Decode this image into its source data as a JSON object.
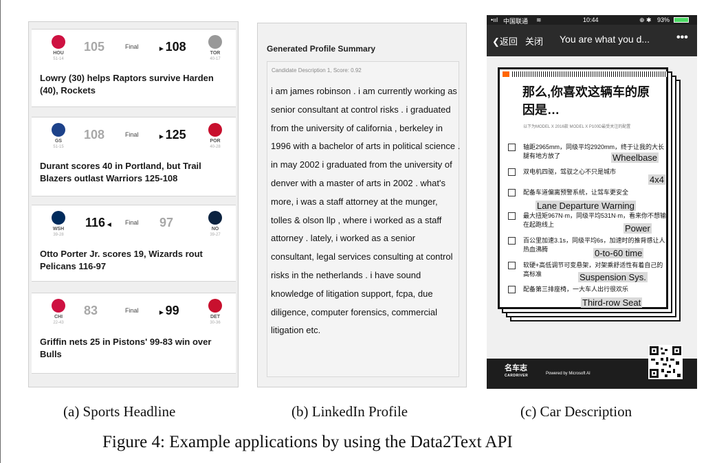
{
  "panel_a": {
    "games": [
      {
        "away": {
          "abbr": "HOU",
          "record": "51-14",
          "score": "105",
          "color": "#ce1141"
        },
        "home": {
          "abbr": "TOR",
          "record": "40-17",
          "score": "108",
          "color": "#999999"
        },
        "status": "Final",
        "winner": "home",
        "headline": "Lowry (30) helps Raptors survive Harden (40), Rockets"
      },
      {
        "away": {
          "abbr": "GS",
          "record": "51-15",
          "score": "108",
          "color": "#1d428a"
        },
        "home": {
          "abbr": "POR",
          "record": "40-28",
          "score": "125",
          "color": "#c8102e"
        },
        "status": "Final",
        "winner": "home",
        "headline": "Durant scores 40 in Portland, but Trail Blazers outlast Warriors 125-108"
      },
      {
        "away": {
          "abbr": "WSH",
          "record": "39-28",
          "score": "116",
          "color": "#002b5c"
        },
        "home": {
          "abbr": "NO",
          "record": "39-27",
          "score": "97",
          "color": "#0c2340"
        },
        "status": "Final",
        "winner": "away",
        "headline": "Otto Porter Jr. scores 19, Wizards rout Pelicans 116-97"
      },
      {
        "away": {
          "abbr": "CHI",
          "record": "22-43",
          "score": "83",
          "color": "#ce1141"
        },
        "home": {
          "abbr": "DET",
          "record": "30-36",
          "score": "99",
          "color": "#c8102e"
        },
        "status": "Final",
        "winner": "home",
        "headline": "Griffin nets 25 in Pistons' 99-83 win over Bulls"
      }
    ],
    "caption": "(a) Sports Headline"
  },
  "panel_b": {
    "title": "Generated Profile Summary",
    "candidate": "Candidate Description 1, Score: 0.92",
    "text": "i am james robinson . i am currently working as senior consultant at control risks . i graduated from the university of california , berkeley in 1996 with a bachelor of arts in political science . in may 2002 i graduated from the university of denver with a master of arts in 2002 . what's more, i was a staff attorney at the munger, tolles & olson llp , where i worked as a staff attorney . lately, i worked as a senior consultant, legal services consulting at control risks in the netherlands . i have sound knowledge of litigation support, fcpa, due diligence, computer forensics, commercial litigation etc.",
    "caption": "(b) LinkedIn Profile"
  },
  "panel_c": {
    "status_bar": {
      "carrier": "中国联通",
      "time": "10:44",
      "battery": "93%"
    },
    "nav": {
      "back": "返回",
      "close": "关闭",
      "title": "You are what you d...",
      "more": "•••"
    },
    "headline": "那么,你喜欢这辆车的原因是…",
    "subtitle": "以下为MODEL X 2016款 MODEL X P100D最受关注的配置",
    "options": [
      {
        "text": "轴距2965mm，同级平均2920mm，终于让我的大长腿有地方放了",
        "tag": "Wheelbase"
      },
      {
        "text": "双电机四驱，驾驭之心不只是城市",
        "tag": "4x4"
      },
      {
        "text": "配备车道偏离预警系统，让驾车更安全",
        "tag": "Lane Departure Warning"
      },
      {
        "text": "最大扭矩967N·m，同级平均531N·m，看来你不想输在起跑线上",
        "tag": "Power"
      },
      {
        "text": "百公里加速3.1s，同级平均6s，加速时的推背感让人热血沸腾",
        "tag": "0-to-60 time"
      },
      {
        "text": "软硬+高低调节可变悬架，对架乘舒适性有着自己的高标准",
        "tag": "Suspension Sys."
      },
      {
        "text": "配备第三排座椅，一大车人出行很欢乐",
        "tag": "Third-row Seat"
      }
    ],
    "footer": {
      "brand": "名车志",
      "brand_en": "CARDRIVER",
      "powered": "Powered by Microsoft AI"
    },
    "caption": "(c) Car Description"
  },
  "figure_caption": "Figure 4: Example applications by using the Data2Text API"
}
